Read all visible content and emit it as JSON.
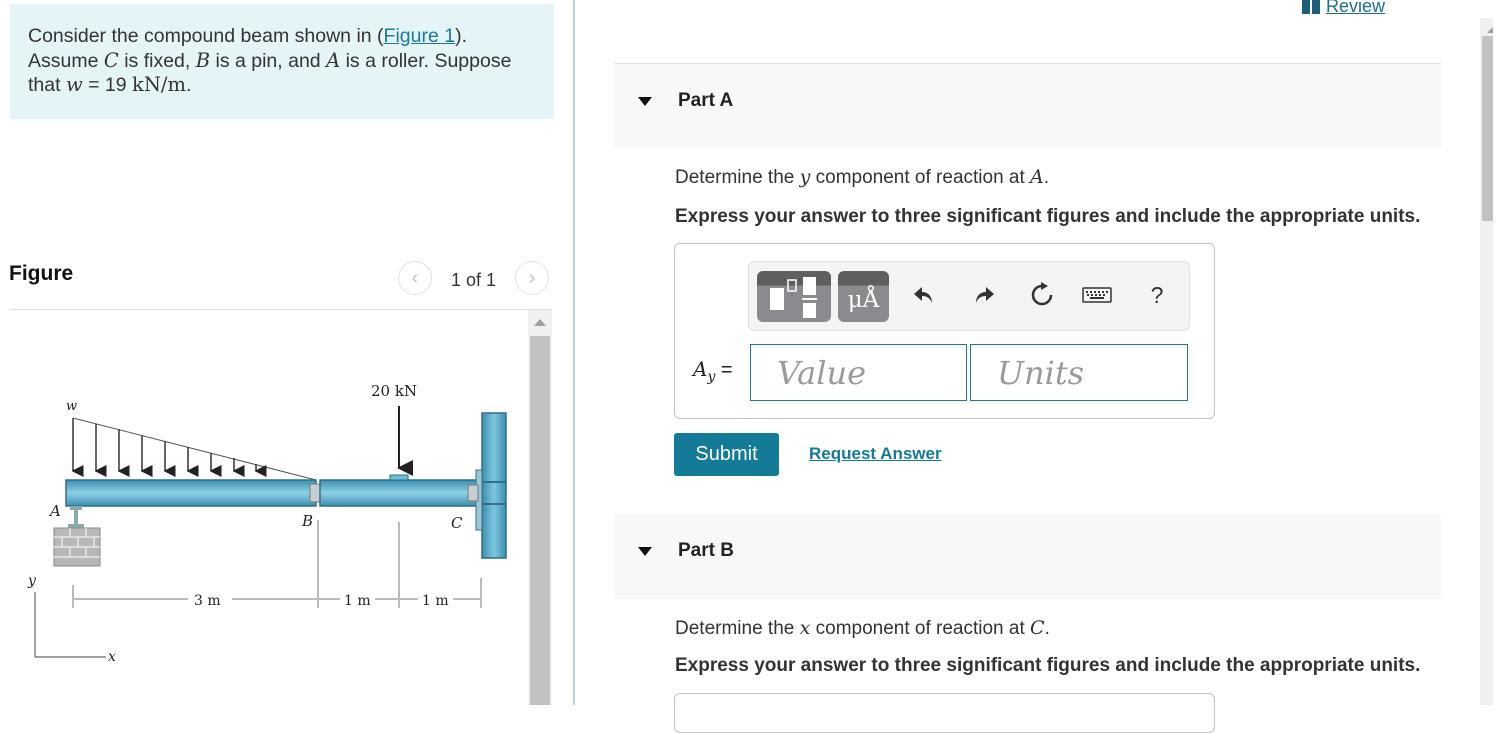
{
  "intro": {
    "line1_pre": "Consider the compound beam shown in (",
    "figure_link": "Figure 1",
    "line1_post": ").",
    "line2_pre": "Assume ",
    "C": "C",
    "line2_mid1": " is fixed, ",
    "B": "B",
    "line2_mid2": " is a pin, and ",
    "A": "A",
    "line2_post": " is a roller. Suppose",
    "line3_pre": "that ",
    "w": "w",
    "line3_eq": " = 19 ",
    "unit": "kN/m",
    "line3_post": "."
  },
  "figure": {
    "title": "Figure",
    "counter": "1 of 1",
    "prev_icon": "chevron-left-icon",
    "next_icon": "chevron-right-icon",
    "labels": {
      "w": "w",
      "A": "A",
      "B": "B",
      "C": "C",
      "force": "20 kN",
      "dim1": "3 m",
      "dim2": "1 m",
      "dim3": "1 m",
      "axis_x": "x",
      "axis_y": "y"
    }
  },
  "review": {
    "label": "Review",
    "icon": "book-icon"
  },
  "partA": {
    "label": "Part A",
    "question_pre": "Determine the ",
    "question_var": "y",
    "question_mid": " component of reaction at ",
    "question_point": "A",
    "question_post": ".",
    "instruction": "Express your answer to three significant figures and include the appropriate units.",
    "toolbar": {
      "template_icon": "fraction-template-icon",
      "units_label": "μÅ",
      "undo_icon": "undo-icon",
      "redo_icon": "redo-icon",
      "reset_icon": "reset-icon",
      "keyboard_icon": "keyboard-icon",
      "help_label": "?"
    },
    "answer_label_var": "A",
    "answer_label_sub": "y",
    "answer_label_eq": " =",
    "value_placeholder": "Value",
    "units_placeholder": "Units",
    "value": "",
    "units": "",
    "submit_label": "Submit",
    "request_label": "Request Answer"
  },
  "partB": {
    "label": "Part B",
    "question_pre": "Determine the ",
    "question_var": "x",
    "question_mid": " component of reaction at ",
    "question_point": "C",
    "question_post": ".",
    "instruction": "Express your answer to three significant figures and include the appropriate units."
  },
  "colors": {
    "accent": "#137b98",
    "intro_bg": "#e5f5f7",
    "beam": "#5fb3cf"
  }
}
